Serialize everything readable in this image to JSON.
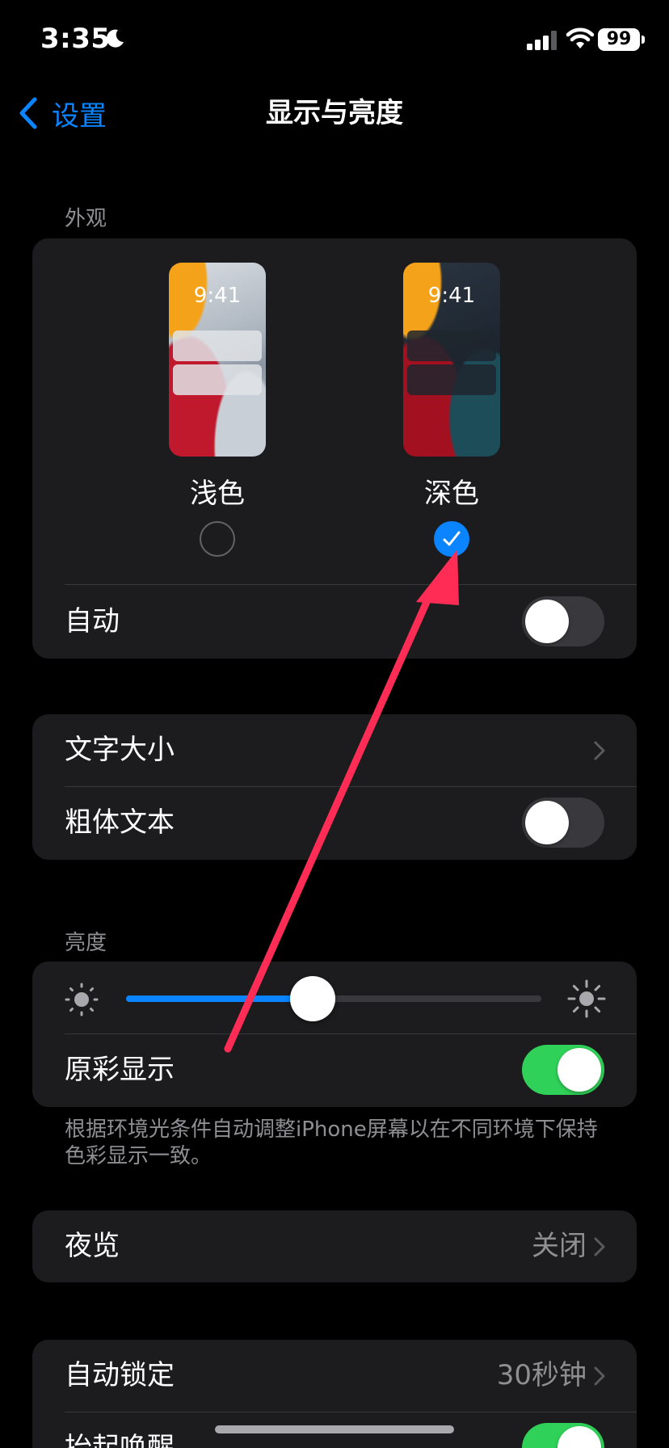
{
  "status_bar": {
    "time": "3:35",
    "battery": "99"
  },
  "nav": {
    "back_label": "设置",
    "title": "显示与亮度"
  },
  "appearance": {
    "header": "外观",
    "options": [
      {
        "label": "浅色",
        "preview_time": "9:41",
        "selected": false
      },
      {
        "label": "深色",
        "preview_time": "9:41",
        "selected": true
      }
    ],
    "auto_label": "自动",
    "auto_on": false
  },
  "text_group": {
    "text_size_label": "文字大小",
    "bold_text_label": "粗体文本",
    "bold_text_on": false
  },
  "brightness": {
    "header": "亮度",
    "level_fraction": 0.45,
    "true_tone_label": "原彩显示",
    "true_tone_on": true,
    "footnote": "根据环境光条件自动调整iPhone屏幕以在不同环境下保持色彩显示一致。"
  },
  "night_shift": {
    "label": "夜览",
    "value": "关闭"
  },
  "lock_group": {
    "auto_lock_label": "自动锁定",
    "auto_lock_value": "30秒钟",
    "raise_to_wake_label": "抬起唤醒",
    "raise_to_wake_on": true
  },
  "colors": {
    "accent": "#0a84ff",
    "toggle_on": "#30d158",
    "annotation": "#ff2d55",
    "background": "#000000",
    "cell": "#1c1c1e"
  }
}
